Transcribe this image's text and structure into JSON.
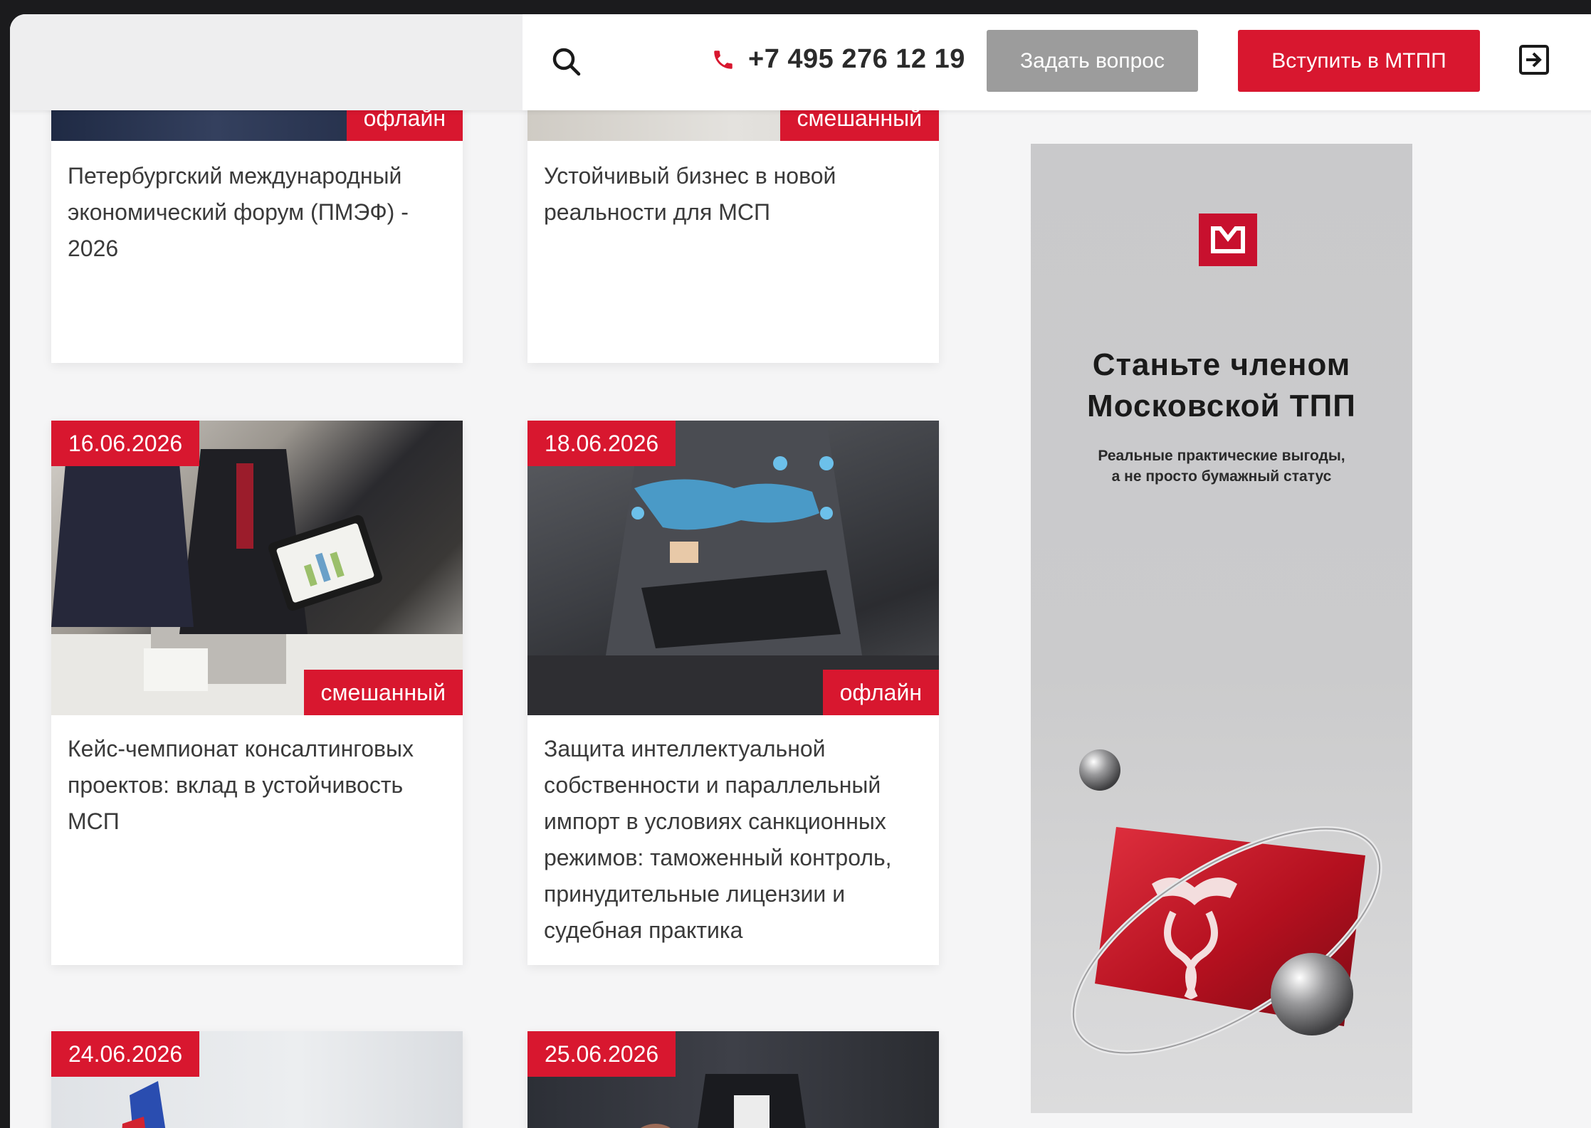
{
  "header": {
    "phone": "+7 495 276 12 19",
    "ask_button": "Задать вопрос",
    "join_button": "Вступить в МТПП"
  },
  "cards": [
    {
      "date": "",
      "format": "офлайн",
      "title": "Петербургский международный экономический форум (ПМЭФ) - 2026"
    },
    {
      "date": "",
      "format": "смешанный",
      "title": "Устойчивый бизнес в новой реальности для МСП"
    },
    {
      "date": "16.06.2026",
      "format": "смешанный",
      "title": "Кейс-чемпионат консалтинговых проектов: вклад в устойчивость МСП"
    },
    {
      "date": "18.06.2026",
      "format": "офлайн",
      "title": "Защита интеллектуальной собственности и параллельный импорт в условиях санкционных режимов: таможенный контроль, принудительные лицензии и судебная практика"
    },
    {
      "date": "24.06.2026",
      "format": "",
      "title": ""
    },
    {
      "date": "25.06.2026",
      "format": "",
      "title": ""
    }
  ],
  "ad": {
    "title": "Станьте членом Московской ТПП",
    "subtitle_line1": "Реальные практические выгоды,",
    "subtitle_line2": "а не просто бумажный статус"
  },
  "colors": {
    "accent": "#d8172f",
    "ask_button_bg": "#9c9c9c",
    "page_bg": "#f5f5f6"
  },
  "icons": {
    "search": "search-icon",
    "phone": "phone-icon",
    "login": "login-icon",
    "ad_logo": "mtpp-logo"
  }
}
